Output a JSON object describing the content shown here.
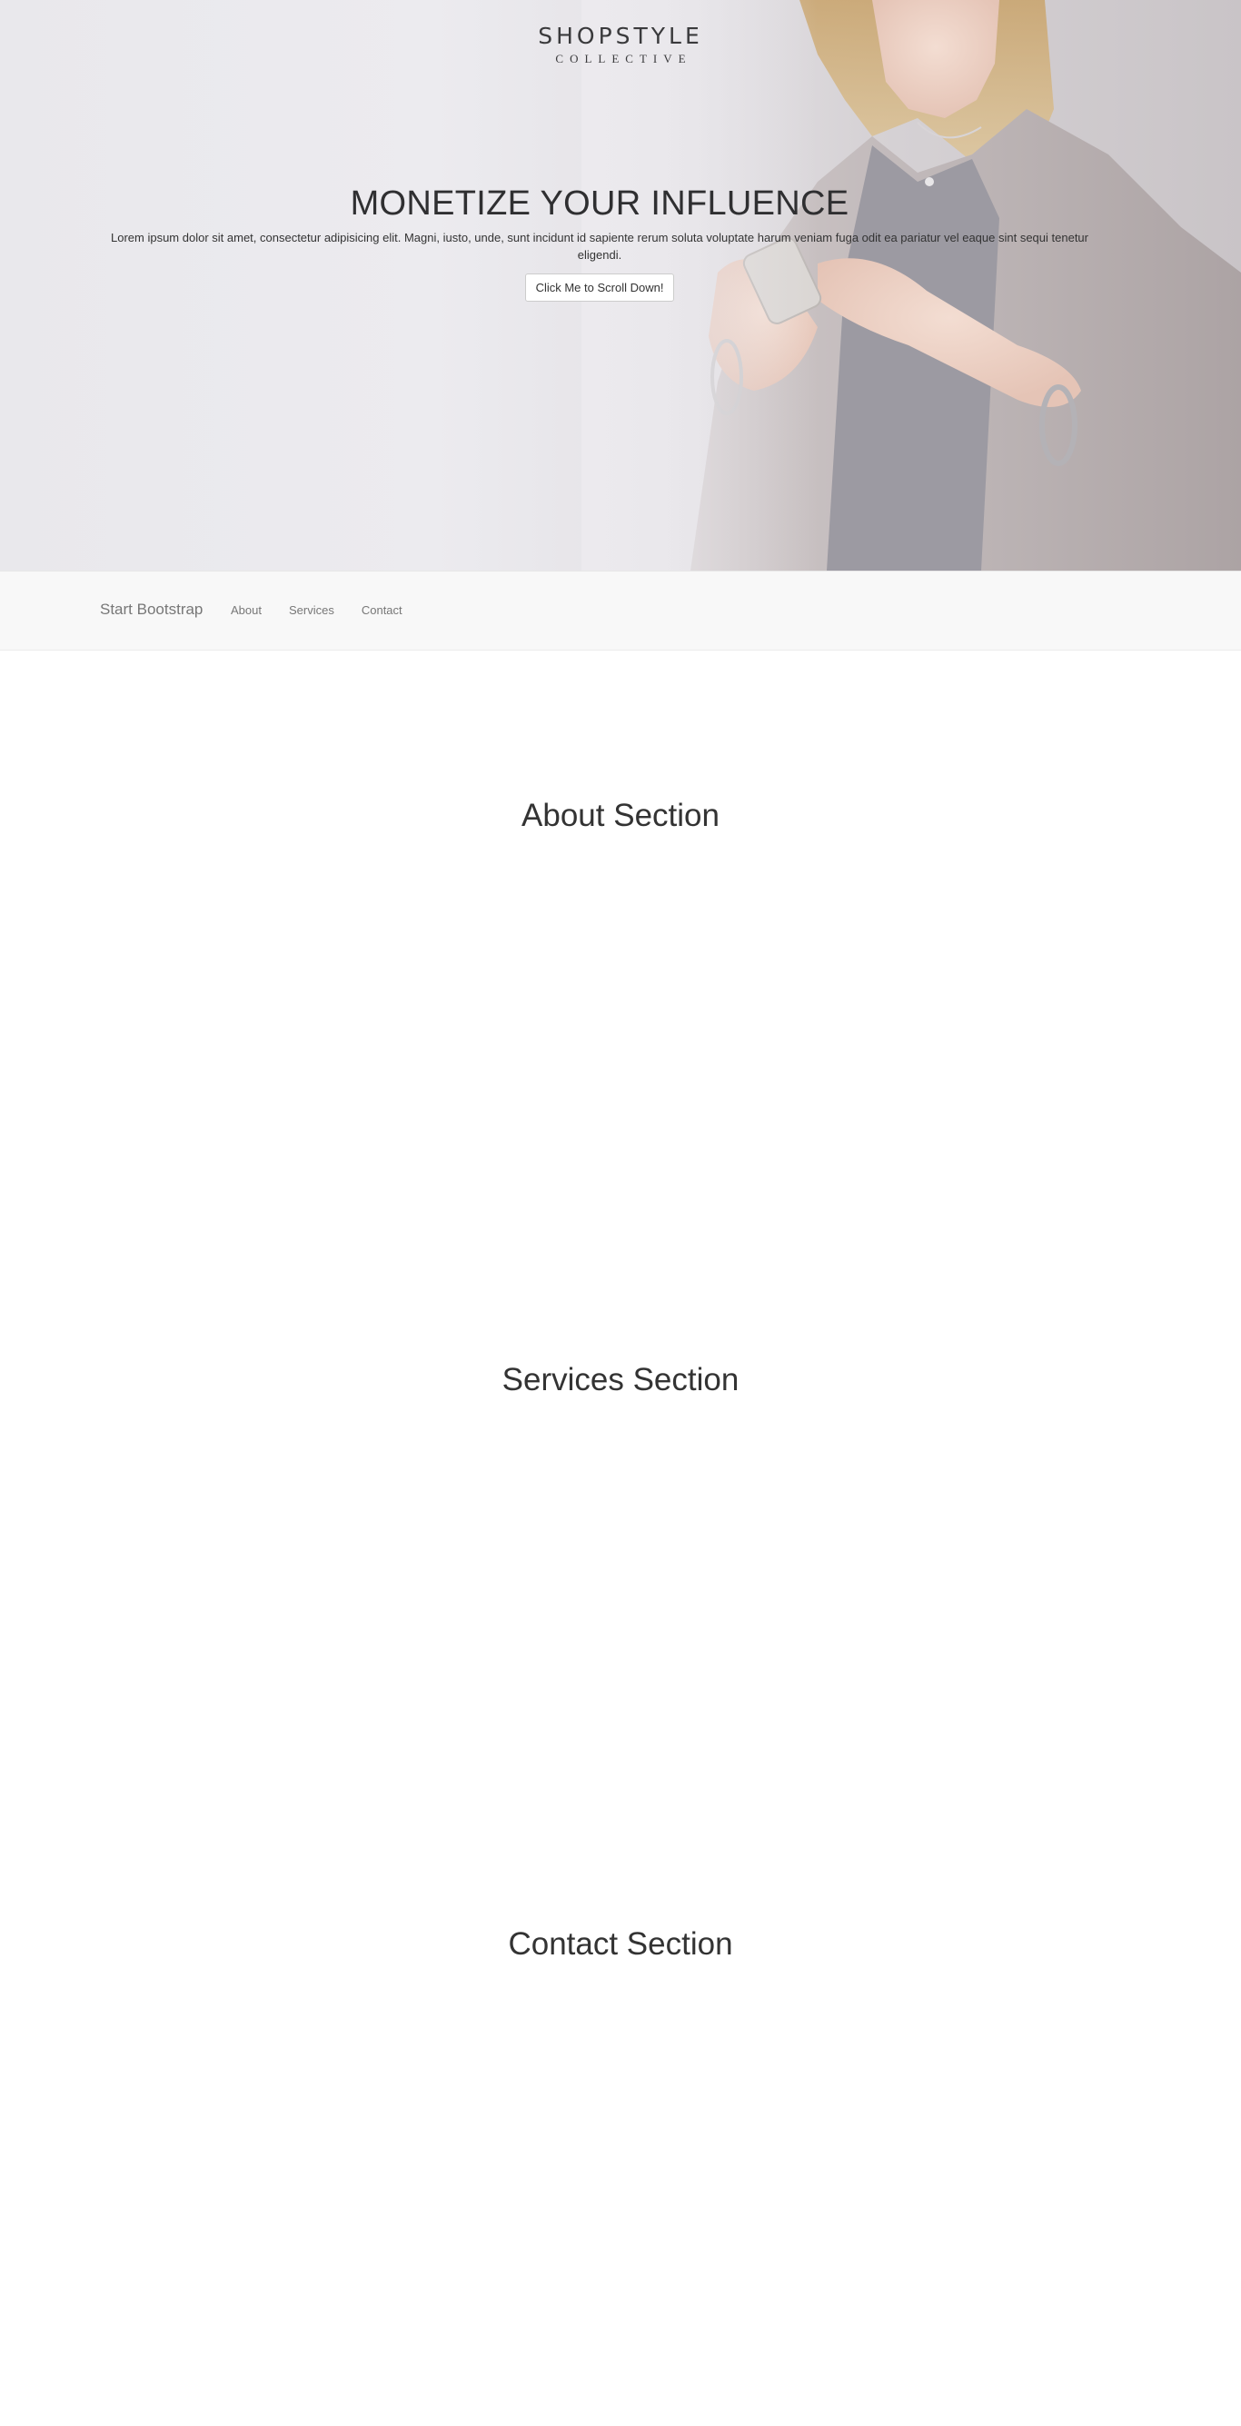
{
  "hero": {
    "logo_main": "SHOPSTYLE",
    "logo_sub": "COLLECTIVE",
    "title": "MONETIZE YOUR INFLUENCE",
    "text": "Lorem ipsum dolor sit amet, consectetur adipisicing elit. Magni, iusto, unde, sunt incidunt id sapiente rerum soluta voluptate harum veniam fuga odit ea pariatur vel eaque sint sequi tenetur eligendi.",
    "button_label": "Click Me to Scroll Down!",
    "photo_subject": "woman-holding-phone-photo"
  },
  "navbar": {
    "brand": "Start Bootstrap",
    "links": [
      {
        "label": "About"
      },
      {
        "label": "Services"
      },
      {
        "label": "Contact"
      }
    ]
  },
  "sections": [
    {
      "title": "About Section"
    },
    {
      "title": "Services Section"
    },
    {
      "title": "Contact Section"
    }
  ],
  "colors": {
    "navbar_bg": "#f8f8f8",
    "text_dark": "#333333",
    "nav_text": "#777777"
  }
}
